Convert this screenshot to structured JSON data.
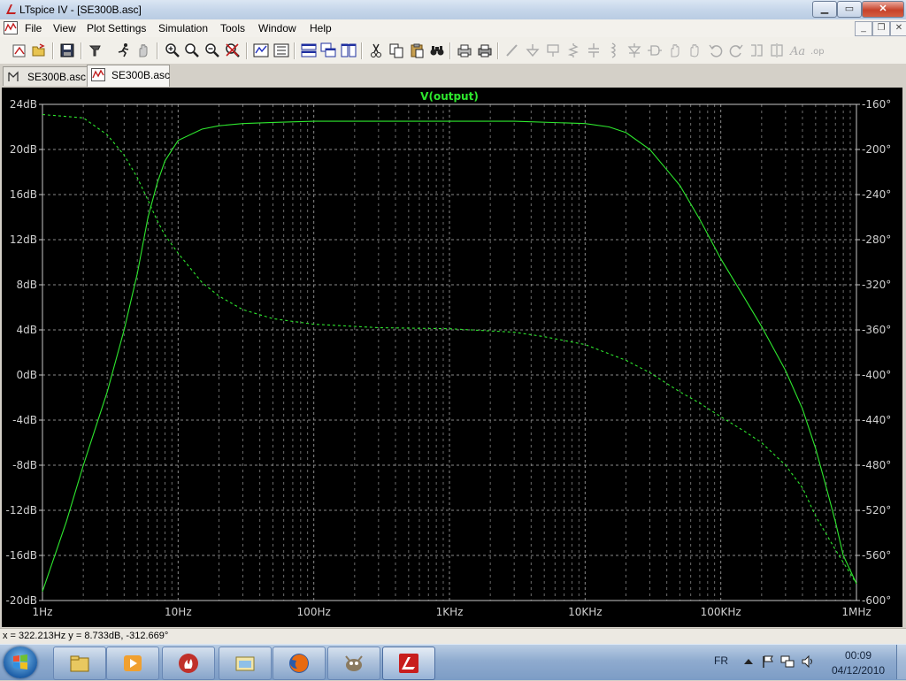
{
  "window": {
    "app_title": "LTspice IV - [SE300B.asc]",
    "minimize": "▁",
    "maximize": "▭",
    "close": "✕"
  },
  "menu": {
    "items": [
      "File",
      "View",
      "Plot Settings",
      "Simulation",
      "Tools",
      "Window",
      "Help"
    ]
  },
  "mdi": {
    "minimize": "_",
    "restore": "❐",
    "close": "✕"
  },
  "tabs": [
    {
      "label": "SE300B.asc",
      "icon": "schematic-icon"
    },
    {
      "label": "SE300B.asc",
      "icon": "waveform-icon",
      "active": true
    }
  ],
  "toolbar": {
    "icons": [
      "new-schematic-icon",
      "open-icon",
      "save-icon",
      "control-panel-icon",
      "run-icon",
      "halt-icon",
      "zoom-in-icon",
      "zoom-pan-icon",
      "zoom-out-icon",
      "zoom-cancel-icon",
      "autorange-icon",
      "fit-icon",
      "tile-horizontal-icon",
      "cascade-icon",
      "tile-vertical-icon",
      "cut-icon",
      "copy-icon",
      "paste-icon",
      "find-icon",
      "print-preview-icon",
      "print-icon",
      "wire-icon",
      "ground-icon",
      "label-icon",
      "resistor-icon",
      "capacitor-icon",
      "inductor-icon",
      "diode-icon",
      "component-icon",
      "move-icon",
      "drag-icon",
      "undo-icon",
      "redo-icon",
      "rotate-icon",
      "mirror-icon",
      "text-icon",
      "spice-directive-icon"
    ]
  },
  "plot": {
    "trace_label": "V(output)",
    "trace_color": "#2ee82e",
    "background": "#000000",
    "grid_color": "#9a9a9a"
  },
  "chart_data": {
    "type": "line",
    "title": "V(output)",
    "x_scale": "log",
    "xlim": [
      1,
      1000000
    ],
    "x_ticks": [
      "1Hz",
      "10Hz",
      "100Hz",
      "1KHz",
      "10KHz",
      "100KHz",
      "1MHz"
    ],
    "y_left_ticks": [
      "24dB",
      "20dB",
      "16dB",
      "12dB",
      "8dB",
      "4dB",
      "0dB",
      "-4dB",
      "-8dB",
      "-12dB",
      "-16dB",
      "-20dB"
    ],
    "y_left_range": [
      -20,
      24
    ],
    "y_right_ticks": [
      "-160°",
      "-200°",
      "-240°",
      "-280°",
      "-320°",
      "-360°",
      "-400°",
      "-440°",
      "-480°",
      "-520°",
      "-560°",
      "-600°"
    ],
    "y_right_range": [
      -600,
      -160
    ],
    "grid": true,
    "series": [
      {
        "name": "V(output)",
        "axis": "left",
        "style": "solid",
        "x": [
          1,
          1.5,
          2,
          3,
          4,
          5,
          6,
          7,
          8,
          10,
          15,
          20,
          30,
          50,
          100,
          300,
          1000,
          3000,
          10000,
          15000,
          20000,
          30000,
          50000,
          70000,
          100000,
          150000,
          200000,
          300000,
          400000,
          500000,
          600000,
          700000,
          800000,
          1000000
        ],
        "y": [
          -19.2,
          -13,
          -8,
          -1.5,
          4,
          9,
          14,
          17,
          19,
          20.8,
          21.8,
          22.1,
          22.3,
          22.4,
          22.5,
          22.5,
          22.5,
          22.5,
          22.3,
          22,
          21.5,
          20,
          16.8,
          13.8,
          10.3,
          6.8,
          4.3,
          0.4,
          -3,
          -6.5,
          -10,
          -13,
          -16,
          -18.5
        ]
      },
      {
        "name": "phase",
        "axis": "right",
        "style": "dashed",
        "x": [
          1,
          2,
          3,
          4,
          5,
          6,
          7,
          8,
          10,
          15,
          20,
          30,
          50,
          100,
          300,
          1000,
          3000,
          5000,
          10000,
          20000,
          30000,
          50000,
          70000,
          100000,
          150000,
          200000,
          300000,
          400000,
          500000,
          700000,
          1000000
        ],
        "y": [
          -169,
          -172,
          -187,
          -205,
          -225,
          -245,
          -263,
          -276,
          -292,
          -318,
          -330,
          -342,
          -350,
          -355,
          -358,
          -359,
          -362,
          -366,
          -373,
          -387,
          -398,
          -415,
          -425,
          -437,
          -450,
          -460,
          -480,
          -500,
          -525,
          -555,
          -585
        ]
      }
    ]
  },
  "status": {
    "text": "x = 322.213Hz   y = 8.733dB, -312.669°"
  },
  "taskbar": {
    "buttons": [
      "explorer-icon",
      "media-player-icon",
      "fire-app-icon",
      "control-panel-icon",
      "firefox-icon",
      "gimp-icon",
      "ltspice-icon"
    ],
    "lang": "FR",
    "time": "00:09",
    "date": "04/12/2010"
  }
}
